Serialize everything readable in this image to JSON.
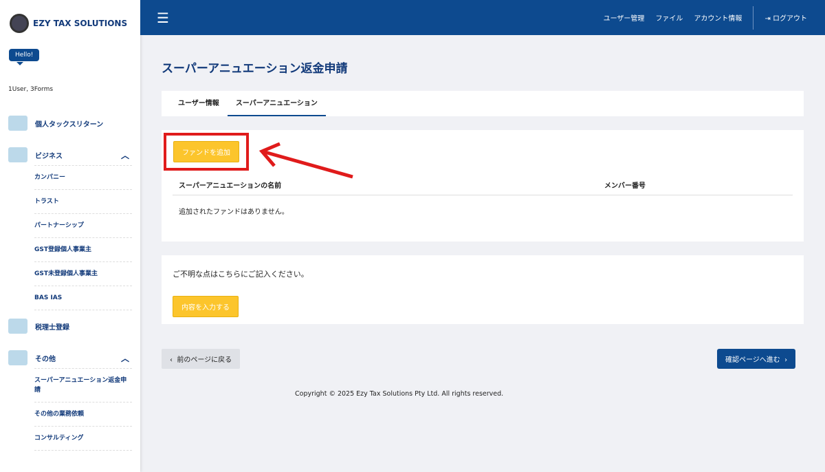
{
  "brand": "EZY TAX SOLUTIONS",
  "hello": "Hello!",
  "counts": "1User, 3Forms",
  "nav": {
    "personal": "個人タックスリターン",
    "business": "ビジネス",
    "business_items": [
      "カンパニー",
      "トラスト",
      "パートナーシップ",
      "GST登録個人事業主",
      "GST未登録個人事業主",
      "BAS IAS"
    ],
    "tax_agent": "税理士登録",
    "other": "その他",
    "other_items": [
      "スーパーアニュエーション返金申請",
      "その他の業務依頼",
      "コンサルティング"
    ]
  },
  "topbar": {
    "user_mgmt": "ユーザー管理",
    "files": "ファイル",
    "account": "アカウント情報",
    "logout": "ログアウト"
  },
  "page_title": "スーパーアニュエーション返金申請",
  "tabs": [
    "ユーザー情報",
    "スーパーアニュエーション"
  ],
  "funds": {
    "add_button": "ファンドを追加",
    "col_name": "スーパーアニュエーションの名前",
    "col_member": "メンバー番号",
    "empty": "追加されたファンドはありません。"
  },
  "inquiry": {
    "text": "ご不明な点はこちらにご記入ください。",
    "button": "内容を入力する"
  },
  "back_button": "前のページに戻る",
  "next_button": "確認ページへ進む",
  "footer": "Copyright © 2025 Ezy Tax Solutions Pty Ltd. All rights reserved.",
  "colors": {
    "primary": "#0d4a8f",
    "accent": "#fcc52c",
    "highlight": "#e01b1b"
  }
}
